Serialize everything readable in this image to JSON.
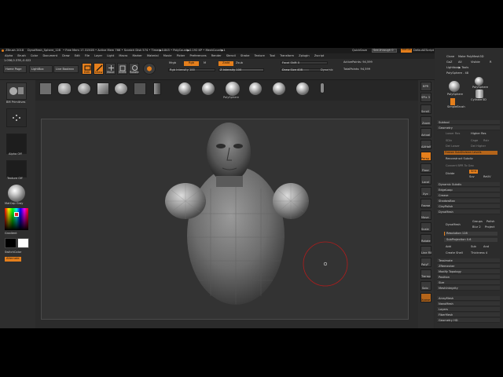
{
  "title_bar": {
    "app": "ZBrush 2018",
    "document": "DynaMesh_Sphere_128",
    "stats": "• Free Mem 17.315GB • Active Mem 766 • Scratch Disk 574 • Timer▶0.845 • PolyCount▶0.192 KP • MeshCount▶1",
    "quicksave": "QuickSave",
    "see_through": "See-through 0",
    "menus_btn": "Menus",
    "script": "DefaultZScript"
  },
  "menu": {
    "items": [
      "Alpha",
      "Brush",
      "Color",
      "Document",
      "Draw",
      "Edit",
      "File",
      "Layer",
      "Light",
      "Macro",
      "Marker",
      "Material",
      "Movie",
      "Picker",
      "Preferences",
      "Render",
      "Stencil",
      "Stroke",
      "Texture",
      "Tool",
      "Transform",
      "Zplugin",
      "Zscript"
    ]
  },
  "coords": "1.056,0.378,-0.022",
  "top_shelf": {
    "home_page": "Home Page",
    "lightbox": "LightBox",
    "live_boolean": "Live Boolean",
    "edit": "Edit",
    "draw": "Draw",
    "move": "Move",
    "scale": "Scale",
    "rotate": "Rotate",
    "mrgb": "Mrgb",
    "rgb": "Rgb",
    "m": "M",
    "zadd": "Zadd",
    "zsub": "Zsub",
    "rgb_intensity": "Rgb Intensity 100",
    "z_intensity": "Z Intensity 100",
    "focal_shift": "Focal Shift 0",
    "draw_size": "Draw Size 408",
    "dynamic": "Dynamic",
    "active_points": "ActivePoints: 94,599",
    "total_points": "TotalPoints: 94,599"
  },
  "tool_shelf": {
    "items": [
      "",
      "",
      "",
      "",
      "",
      "",
      "",
      "",
      "",
      "PolySphere",
      "",
      "",
      "",
      ""
    ],
    "label": "PolySphere"
  },
  "left_tray": {
    "brush_label": "BM Primitives",
    "alpha_label": "Alpha Off",
    "texture_label": "Texture Off",
    "material_label": "MatCap Gray",
    "gradient_label": "Gradient",
    "switch_color": "SwitchColor",
    "alternate": "Alternate"
  },
  "right_icons": [
    "BPR",
    "SPix 3",
    "Scroll",
    "Zoom",
    "Actual",
    "AAHalf",
    "Persp",
    "Floor",
    "Local",
    "Xyz",
    "Frame",
    "Move",
    "Scale",
    "Rotate",
    "Line Fill",
    "PolyF",
    "Transp",
    "Solo",
    "Xpose"
  ],
  "right_panel": {
    "clone": "Clone",
    "make_polymesh": "Make PolyMesh3D",
    "goz": "GoZ",
    "all": "All",
    "visible": "Visible",
    "r": "R",
    "lightbox_tools": "Lightbox▶ Tools",
    "polysphere_label": "PolySphere . 48",
    "thumbs": [
      "PolySphere",
      "PolySphere",
      "Cylinder3D",
      "SimpleBrush"
    ],
    "subtool": "Subtool",
    "geometry": "Geometry",
    "lower_res": "Lower Res",
    "higher_res": "Higher Res",
    "sdiv": "SDiv",
    "cage": "Cage",
    "rstr": "Rstr",
    "del_lower": "Del Lower",
    "del_higher": "Del Higher",
    "freeze_subdiv": "Freeze SubDivision Levels",
    "reconstruct": "Reconstruct Subdiv",
    "convert_bpr": "Convert BPR To Geo",
    "divide": "Divide",
    "smt": "Smt",
    "suv": "Suv",
    "reuv": "ReUV",
    "dynamic_subdiv": "Dynamic Subdiv",
    "edgeloop": "EdgeLoop",
    "crease": "Crease",
    "shadowbox": "ShadowBox",
    "claypolish": "ClayPolish",
    "dynamesh": "DynaMesh",
    "dynamesh_btn": "DynaMesh",
    "groups": "Groups",
    "polish": "Polish",
    "blur": "Blur 2",
    "project": "Project",
    "resolution": "Resolution 128",
    "subprojection": "SubProjection 0.6",
    "add": "Add",
    "sub": "Sub",
    "and": "And",
    "create_shell": "Create Shell",
    "thickness": "Thickness 4",
    "tessimate": "Tessimate",
    "zremesher": "ZRemesher",
    "modify_topology": "Modify Topology",
    "position": "Position",
    "size": "Size",
    "meshintegrity": "MeshIntegrity",
    "arraymesh": "ArrayMesh",
    "nanomesh": "NanoMesh",
    "layers": "Layers",
    "fibermesh": "FiberMesh",
    "geometry_hd": "Geometry HD"
  },
  "canvas": {
    "brush_cursor": "circle-cursor"
  }
}
